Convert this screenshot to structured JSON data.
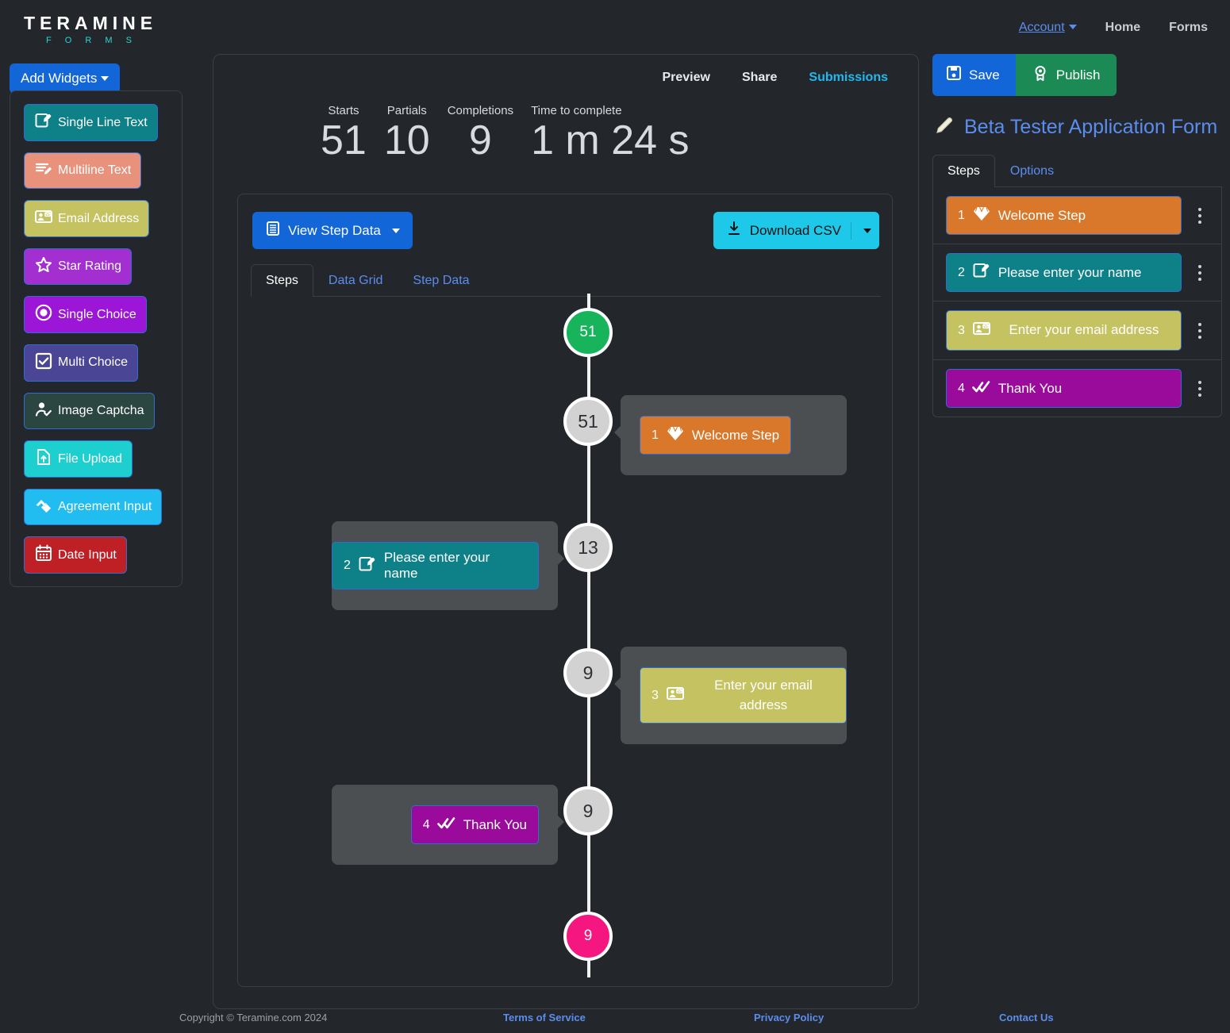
{
  "brand": {
    "name": "TERAMINE",
    "sub": "F O R M S"
  },
  "topnav": {
    "account": "Account",
    "home": "Home",
    "forms": "Forms"
  },
  "left": {
    "add_widgets_label": "Add Widgets",
    "widgets": [
      {
        "label": "Single Line Text",
        "icon": "pencil-square-icon",
        "color": "#0e8088"
      },
      {
        "label": "Multiline Text",
        "icon": "lines-pencil-icon",
        "color": "#e8927c"
      },
      {
        "label": "Email Address",
        "icon": "contact-card-icon",
        "color": "#c4c261"
      },
      {
        "label": "Star Rating",
        "icon": "star-icon",
        "color": "#a32fd0"
      },
      {
        "label": "Single Choice",
        "icon": "radio-button-icon",
        "color": "#9b16d6"
      },
      {
        "label": "Multi Choice",
        "icon": "checkbox-icon",
        "color": "#4b4595"
      },
      {
        "label": "Image Captcha",
        "icon": "person-check-icon",
        "color": "#2b4540"
      },
      {
        "label": "File Upload",
        "icon": "file-upload-icon",
        "color": "#1ecfd0"
      },
      {
        "label": "Agreement Input",
        "icon": "handshake-icon",
        "color": "#22bdf0"
      },
      {
        "label": "Date Input",
        "icon": "calendar-icon",
        "color": "#bf2026"
      }
    ]
  },
  "center": {
    "subnav": {
      "preview": "Preview",
      "share": "Share",
      "submissions": "Submissions"
    },
    "stats": [
      {
        "label": "Starts",
        "value": "51"
      },
      {
        "label": "Partials",
        "value": "10"
      },
      {
        "label": "Completions",
        "value": "9"
      },
      {
        "label": "Time to complete",
        "value": "1 m 24 s"
      }
    ],
    "view_step_data_label": "View Step Data",
    "download_csv_label": "Download CSV",
    "tabs": [
      {
        "label": "Steps",
        "active": true
      },
      {
        "label": "Data Grid",
        "active": false
      },
      {
        "label": "Step Data",
        "active": false
      }
    ],
    "funnel": {
      "nodes": [
        {
          "value": "51",
          "kind": "green"
        },
        {
          "value": "51",
          "kind": "grey"
        },
        {
          "value": "13",
          "kind": "grey"
        },
        {
          "value": "9",
          "kind": "grey"
        },
        {
          "value": "9",
          "kind": "grey"
        },
        {
          "value": "9",
          "kind": "pink"
        }
      ],
      "steps": [
        {
          "num": "1",
          "label": "Welcome Step",
          "icon": "diamond-icon",
          "color": "#d9782a",
          "side": "right",
          "two_line": false
        },
        {
          "num": "2",
          "label": "Please enter your name",
          "icon": "pencil-square-icon",
          "color": "#0e8088",
          "side": "left",
          "two_line": false
        },
        {
          "num": "3",
          "label": "Enter your email address",
          "icon": "contact-card-icon",
          "color": "#c4c261",
          "side": "right",
          "two_line": true
        },
        {
          "num": "4",
          "label": "Thank You",
          "icon": "double-check-icon",
          "color": "#9b0b9b",
          "side": "left",
          "two_line": false
        }
      ]
    }
  },
  "right": {
    "save_label": "Save",
    "publish_label": "Publish",
    "form_title": "Beta Tester Application Form",
    "tabs": [
      {
        "label": "Steps",
        "active": true
      },
      {
        "label": "Options",
        "active": false
      }
    ],
    "steps": [
      {
        "num": "1",
        "label": "Welcome Step",
        "icon": "diamond-icon",
        "color": "#d9782a",
        "two_line": false
      },
      {
        "num": "2",
        "label": "Please enter your name",
        "icon": "pencil-square-icon",
        "color": "#0e8088",
        "two_line": false
      },
      {
        "num": "3",
        "label": "Enter your email address",
        "icon": "contact-card-icon",
        "color": "#c4c261",
        "two_line": true
      },
      {
        "num": "4",
        "label": "Thank You",
        "icon": "double-check-icon",
        "color": "#9b0b9b",
        "two_line": false
      }
    ]
  },
  "footer": {
    "copyright": "Copyright © Teramine.com 2024",
    "terms": "Terms of Service",
    "privacy": "Privacy Policy",
    "contact": "Contact Us"
  }
}
